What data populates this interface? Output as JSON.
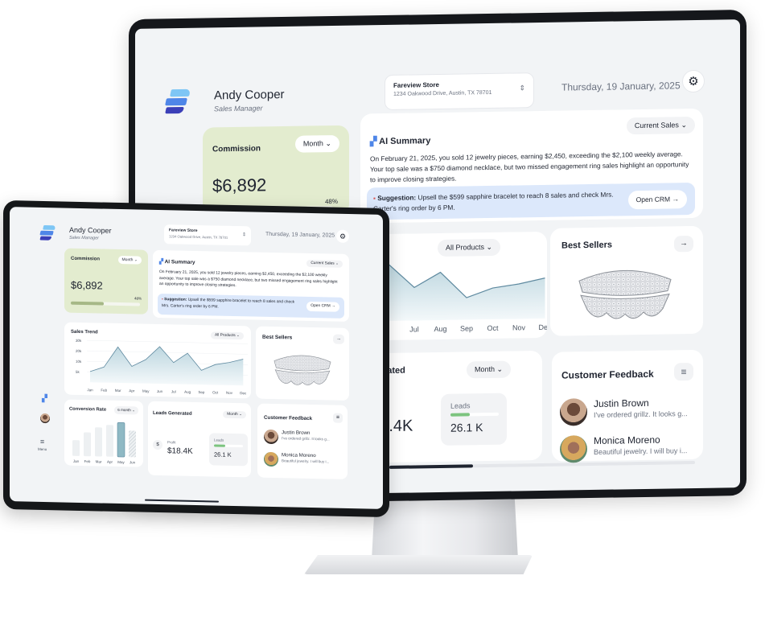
{
  "user": {
    "name": "Andy Cooper",
    "role": "Sales Manager"
  },
  "store": {
    "name": "Fareview Store",
    "address": "1234 Oakwood Drive, Austin, TX 78701"
  },
  "date": "Thursday, 19 January, 2025",
  "commission": {
    "title": "Commission",
    "period": "Month",
    "value": "$6,892",
    "progress_pct": 48,
    "progress_label": "48%"
  },
  "ai_summary": {
    "title": "AI Summary",
    "filter": "Current Sales",
    "text": "On February 21, 2025, you sold 12 jewelry pieces, earning $2,450, exceeding the $2,100 weekly average. Your top sale was a $750 diamond necklace, but two missed engagement ring sales highlight an opportunity to improve closing strategies.",
    "suggestion_label": "Suggestion:",
    "suggestion_text": "Upsell the $599 sapphire bracelet to reach 8 sales and check Mrs. Carter's ring order by 6 PM.",
    "open_crm": "Open CRM"
  },
  "sales_trend": {
    "title": "Sales Trend",
    "filter": "All Products"
  },
  "best_sellers": {
    "title": "Best Sellers"
  },
  "leads": {
    "title": "Leads Generated",
    "monitor_title": "enerated",
    "period": "Month",
    "profit_label": "Profit",
    "profit_partial": "rofit",
    "profit_value": "$18.4K",
    "profit_value_partial": "$18.4K",
    "leads_label": "Leads",
    "leads_value": "26.1 K",
    "leads_progress_pct": 40
  },
  "conversion": {
    "title": "Conversion Rate",
    "period": "6 month"
  },
  "customer_feedback": {
    "title": "Customer Feedback",
    "items": [
      {
        "name": "Justin Brown",
        "text": "I've ordered grillz. It looks g..."
      },
      {
        "name": "Monica Moreno",
        "text": "Beautiful jewelry. I will buy i..."
      }
    ],
    "tablet_items": [
      {
        "name": "Justin Brown",
        "text": "I've ordered grillz. It looks g..."
      },
      {
        "name": "Monica Moreno",
        "text": "Beautiful jewelry. I will buy i..."
      }
    ]
  },
  "nav": {
    "menu_label": "Menu"
  },
  "colors": {
    "accent_green": "#a6b886",
    "commission_bg": "#e3eccf",
    "suggestion_bg": "#dce8fb",
    "chart_line": "#5f8aa0",
    "bar_accent": "#8fb9c4"
  },
  "chart_data": [
    {
      "type": "area",
      "title": "Sales Trend",
      "categories": [
        "Jan",
        "Feb",
        "Mar",
        "Apr",
        "May",
        "Jun",
        "Jul",
        "Aug",
        "Sep",
        "Oct",
        "Nov",
        "Dec"
      ],
      "values": [
        9,
        13,
        30,
        14,
        20,
        31,
        18,
        26,
        12,
        17,
        19,
        22
      ],
      "yticks": [
        "30k",
        "20k",
        "10k",
        "5k"
      ],
      "ylim": [
        0,
        35
      ]
    },
    {
      "type": "bar",
      "title": "Conversion Rate",
      "categories": [
        "Jan",
        "Feb",
        "Mar",
        "Apr",
        "May",
        "Jun"
      ],
      "values": [
        30,
        45,
        55,
        60,
        65,
        50
      ],
      "highlight": "May"
    }
  ]
}
